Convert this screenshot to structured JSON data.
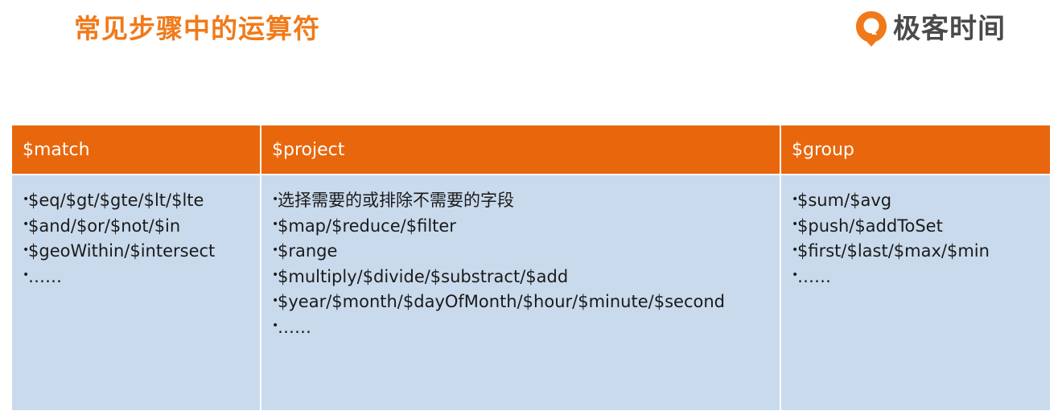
{
  "slide": {
    "title": "常见步骤中的运算符",
    "brand": {
      "name": "极客时间",
      "color": "#f07a1a"
    }
  },
  "colors": {
    "header_bg": "#e8670c",
    "cell_bg": "#c9daec",
    "title": "#f07a1a"
  },
  "table": {
    "headers": [
      "$match",
      "$project",
      "$group"
    ],
    "columns": [
      {
        "items": [
          "$eq/$gt/$gte/$lt/$lte",
          "$and/$or/$not/$in",
          "$geoWithin/$intersect",
          "……"
        ]
      },
      {
        "items": [
          "选择需要的或排除不需要的字段",
          "$map/$reduce/$filter",
          "$range",
          "$multiply/$divide/$substract/$add",
          "$year/$month/$dayOfMonth/$hour/$minute/$second",
          "……"
        ]
      },
      {
        "items": [
          "$sum/$avg",
          "$push/$addToSet",
          "$first/$last/$max/$min",
          "……"
        ]
      }
    ]
  }
}
